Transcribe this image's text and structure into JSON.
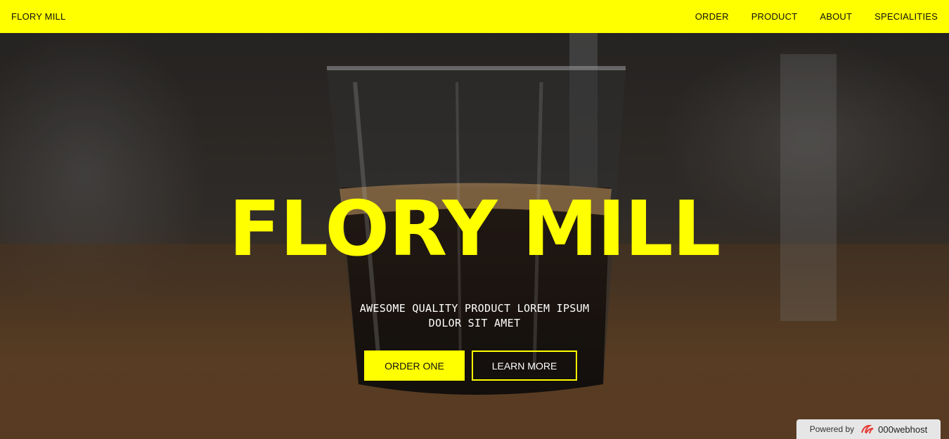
{
  "nav": {
    "brand": "FLORY MILL",
    "links": [
      "ORDER",
      "PRODUCT",
      "ABOUT",
      "SPECIALITIES"
    ]
  },
  "hero": {
    "title": "FLORY MILL",
    "subtitle": "AWESOME QUALITY PRODUCT LOREM IPSUM DOLOR SIT AMET",
    "primary_button": "ORDER ONE",
    "secondary_button": "LEARN MORE"
  },
  "badge": {
    "prefix": "Powered by",
    "brand": "000webhost"
  },
  "colors": {
    "accent": "#ffff00",
    "nav_text": "#111111",
    "hero_text": "#ffffff"
  }
}
